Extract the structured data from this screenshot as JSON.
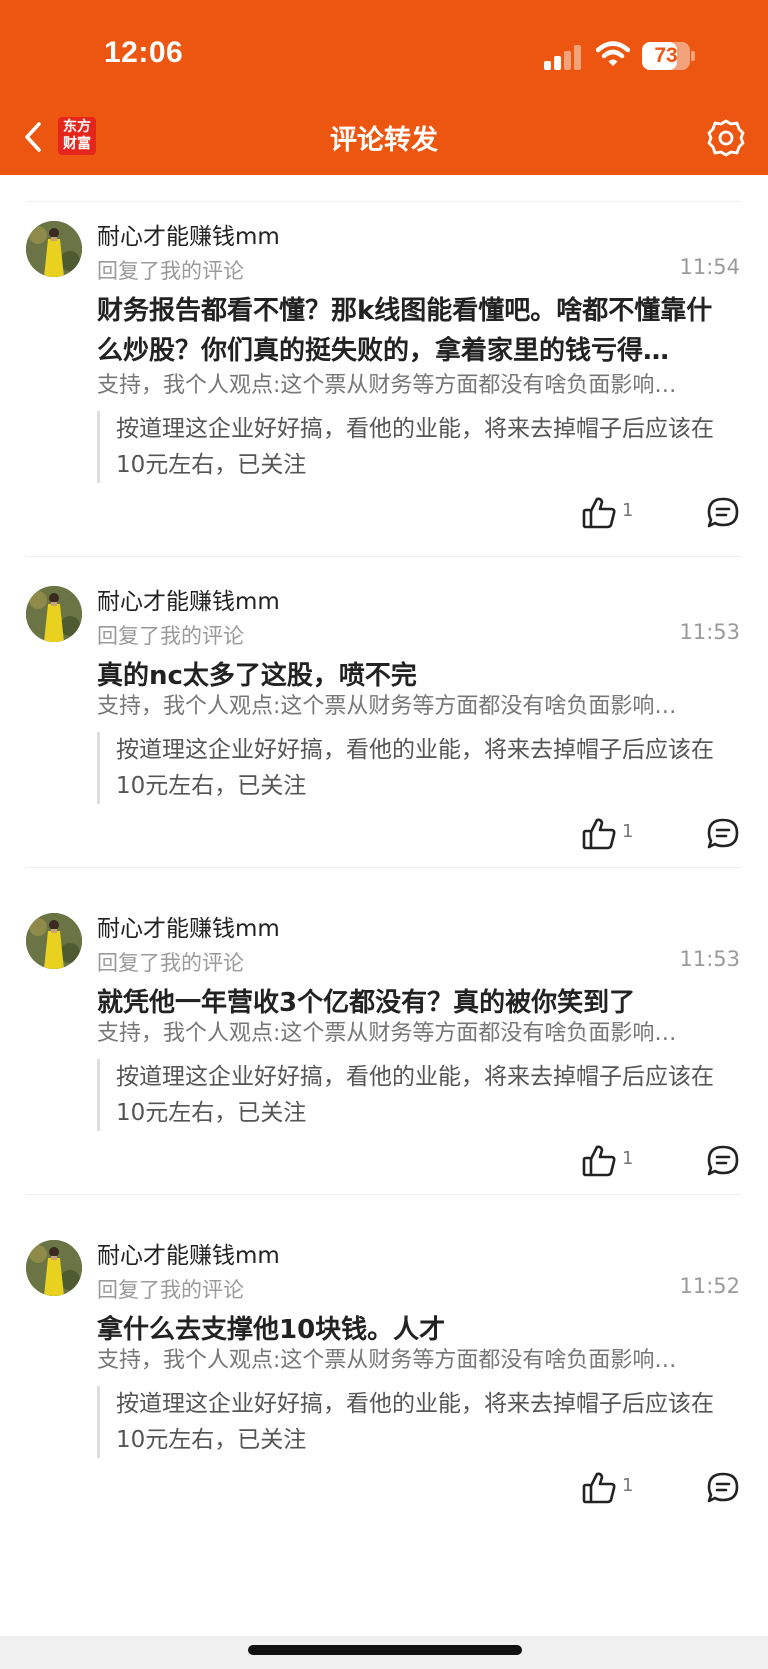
{
  "status_bar": {
    "time": "12:06",
    "battery": "73",
    "battery_level": 0.73
  },
  "header": {
    "title": "评论转发",
    "logo_line1": "东方",
    "logo_line2": "财富"
  },
  "colors": {
    "brand": "#EC5611",
    "logo": "#E6261D"
  },
  "icons": [
    "back-chevron-icon",
    "gear-icon",
    "thumbs-up-icon",
    "comment-bubble-icon",
    "cellular-signal-icon",
    "wifi-icon",
    "battery-icon"
  ],
  "comments": [
    {
      "user": "耐心才能赚钱mm",
      "subtitle": "回复了我的评论",
      "time": "11:54",
      "text": "财务报告都看不懂？那k线图能看懂吧。啥都不懂靠什么炒股？你们真的挺失败的，拿着家里的钱亏得…",
      "original": "支持，我个人观点:这个票从财务等方面都没有啥负面影响…",
      "quote": "按道理这企业好好搞，看他的业能，将来去掉帽子后应该在10元左右，已关注",
      "likes": "1"
    },
    {
      "user": "耐心才能赚钱mm",
      "subtitle": "回复了我的评论",
      "time": "11:53",
      "text": "真的nc太多了这股，喷不完",
      "original": "支持，我个人观点:这个票从财务等方面都没有啥负面影响…",
      "quote": "按道理这企业好好搞，看他的业能，将来去掉帽子后应该在10元左右，已关注",
      "likes": "1"
    },
    {
      "user": "耐心才能赚钱mm",
      "subtitle": "回复了我的评论",
      "time": "11:53",
      "text": "就凭他一年营收3个亿都没有？真的被你笑到了",
      "original": "支持，我个人观点:这个票从财务等方面都没有啥负面影响…",
      "quote": "按道理这企业好好搞，看他的业能，将来去掉帽子后应该在10元左右，已关注",
      "likes": "1"
    },
    {
      "user": "耐心才能赚钱mm",
      "subtitle": "回复了我的评论",
      "time": "11:52",
      "text": "拿什么去支撑他10块钱。人才",
      "original": "支持，我个人观点:这个票从财务等方面都没有啥负面影响…",
      "quote": "按道理这企业好好搞，看他的业能，将来去掉帽子后应该在10元左右，已关注",
      "likes": "1"
    }
  ]
}
